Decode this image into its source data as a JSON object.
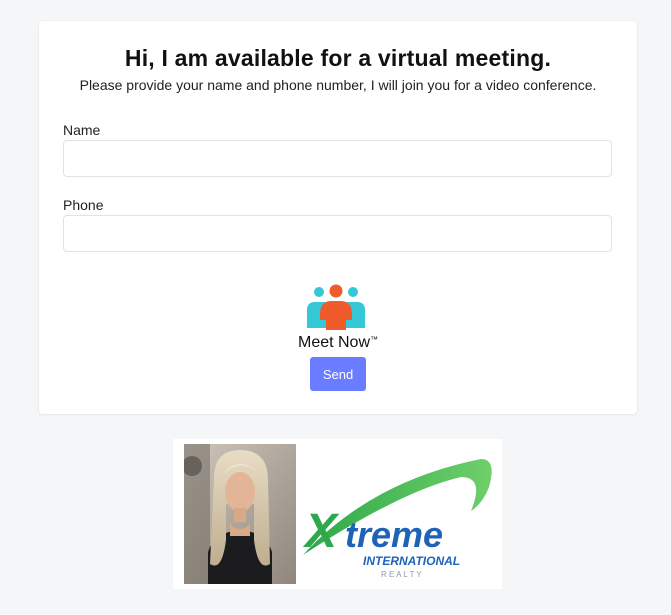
{
  "form": {
    "title": "Hi, I am available for a virtual meeting.",
    "subtitle": "Please provide your name and phone number, I will join you for a video conference.",
    "name_label": "Name",
    "name_value": "",
    "phone_label": "Phone",
    "phone_value": "",
    "meet_label": "Meet Now",
    "meet_tm": "™",
    "send_label": "Send"
  },
  "banner": {
    "logo_word": "treme",
    "logo_initial": "X",
    "logo_line2": "INTERNATIONAL",
    "logo_line3": "R E A L T Y"
  },
  "colors": {
    "accent": "#6a7cff",
    "page_bg": "#f5f6f8",
    "icon_orange": "#ef5b2b",
    "icon_teal": "#35c8d6",
    "logo_green": "#2ea84a",
    "logo_blue": "#1e63b8"
  }
}
